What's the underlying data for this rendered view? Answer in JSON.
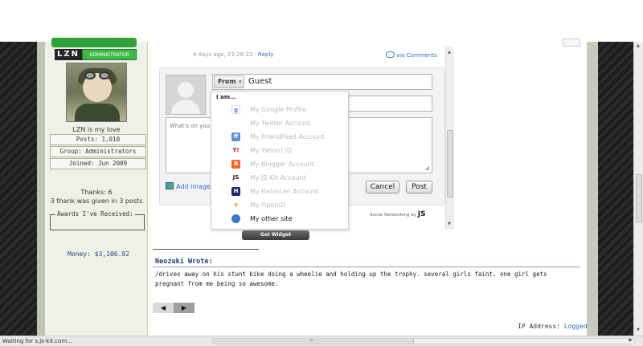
{
  "profile": {
    "badge_tag": "LZN",
    "role_label": "ADMINISTRATOR",
    "tagline": "LZN is my love",
    "stats": [
      "Posts: 1,010",
      "Group: Administrators",
      "Joined: Jun 2009"
    ],
    "thanks": "Thanks: 6",
    "thanks_given": "3 thank was given in 3 posts",
    "awards_label": "Awards I've Received:",
    "money": "Money: $3,106.92"
  },
  "widget": {
    "meta": "4 days ago, 23:28:33 ·",
    "reply": "Reply",
    "via": "via Comments",
    "from_label": "From",
    "from_value": "Guest",
    "textarea_placeholder": "What's on you",
    "add_image": "Add image",
    "cancel": "Cancel",
    "post": "Post",
    "social_prefix": "Social Networking by",
    "social_brand": "JS",
    "get_widget": "Get Widget"
  },
  "dropdown": {
    "header": "I am...",
    "items": [
      {
        "label": "My Google Profile",
        "icon": "google-icon",
        "color": "#4285f4"
      },
      {
        "label": "My Twitter Account",
        "icon": "twitter-icon",
        "color": "#ffffff"
      },
      {
        "label": "My FriendFeed Account",
        "icon": "friendfeed-icon",
        "color": "#5b8ed6"
      },
      {
        "label": "My Yahoo! ID",
        "icon": "yahoo-icon",
        "color": "#c00e1e"
      },
      {
        "label": "My Blogger Account",
        "icon": "blogger-icon",
        "color": "#f26522"
      },
      {
        "label": "My JS-Kit Account",
        "icon": "jskit-icon",
        "color": "#222222"
      },
      {
        "label": "My Haloscan Account",
        "icon": "haloscan-icon",
        "color": "#1a2a6e"
      },
      {
        "label": "My OpenID",
        "icon": "openid-icon",
        "color": "#f7931e"
      },
      {
        "label": "My other site",
        "icon": "globe-icon",
        "color": "#3a78c6"
      }
    ]
  },
  "post": {
    "author_title": "Neozuki Wrote:",
    "body": "/drives away on his stunt bike doing a wheelie and holding up the trophy. several girls faint. one girl gets pregnant from me being so awesome.",
    "ip_label": "IP Address:",
    "ip_value": "Logged"
  },
  "status": {
    "text": "Waiting for s.js-kit.com..."
  }
}
